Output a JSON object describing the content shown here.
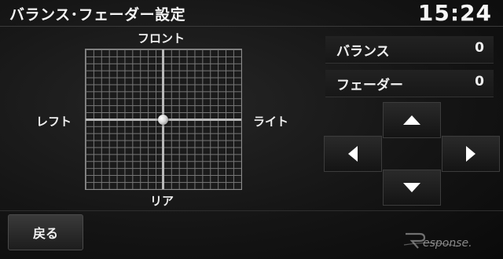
{
  "header": {
    "title": "バランス･フェーダー設定",
    "clock": "15:24"
  },
  "grid": {
    "front_label": "フロント",
    "rear_label": "リア",
    "left_label": "レフト",
    "right_label": "ライト"
  },
  "balance": {
    "label": "バランス",
    "value": "0"
  },
  "fader": {
    "label": "フェーダー",
    "value": "0"
  },
  "arrows": {
    "up": "arrow-up-icon",
    "down": "arrow-down-icon",
    "left": "arrow-left-icon",
    "right": "arrow-right-icon"
  },
  "footer": {
    "back_label": "戻る"
  },
  "watermark": {
    "text": "Response."
  },
  "colors": {
    "background": "#151515",
    "grid_line": "#777777",
    "axis_line": "#b8b8b8",
    "text": "#f0f0f0"
  }
}
